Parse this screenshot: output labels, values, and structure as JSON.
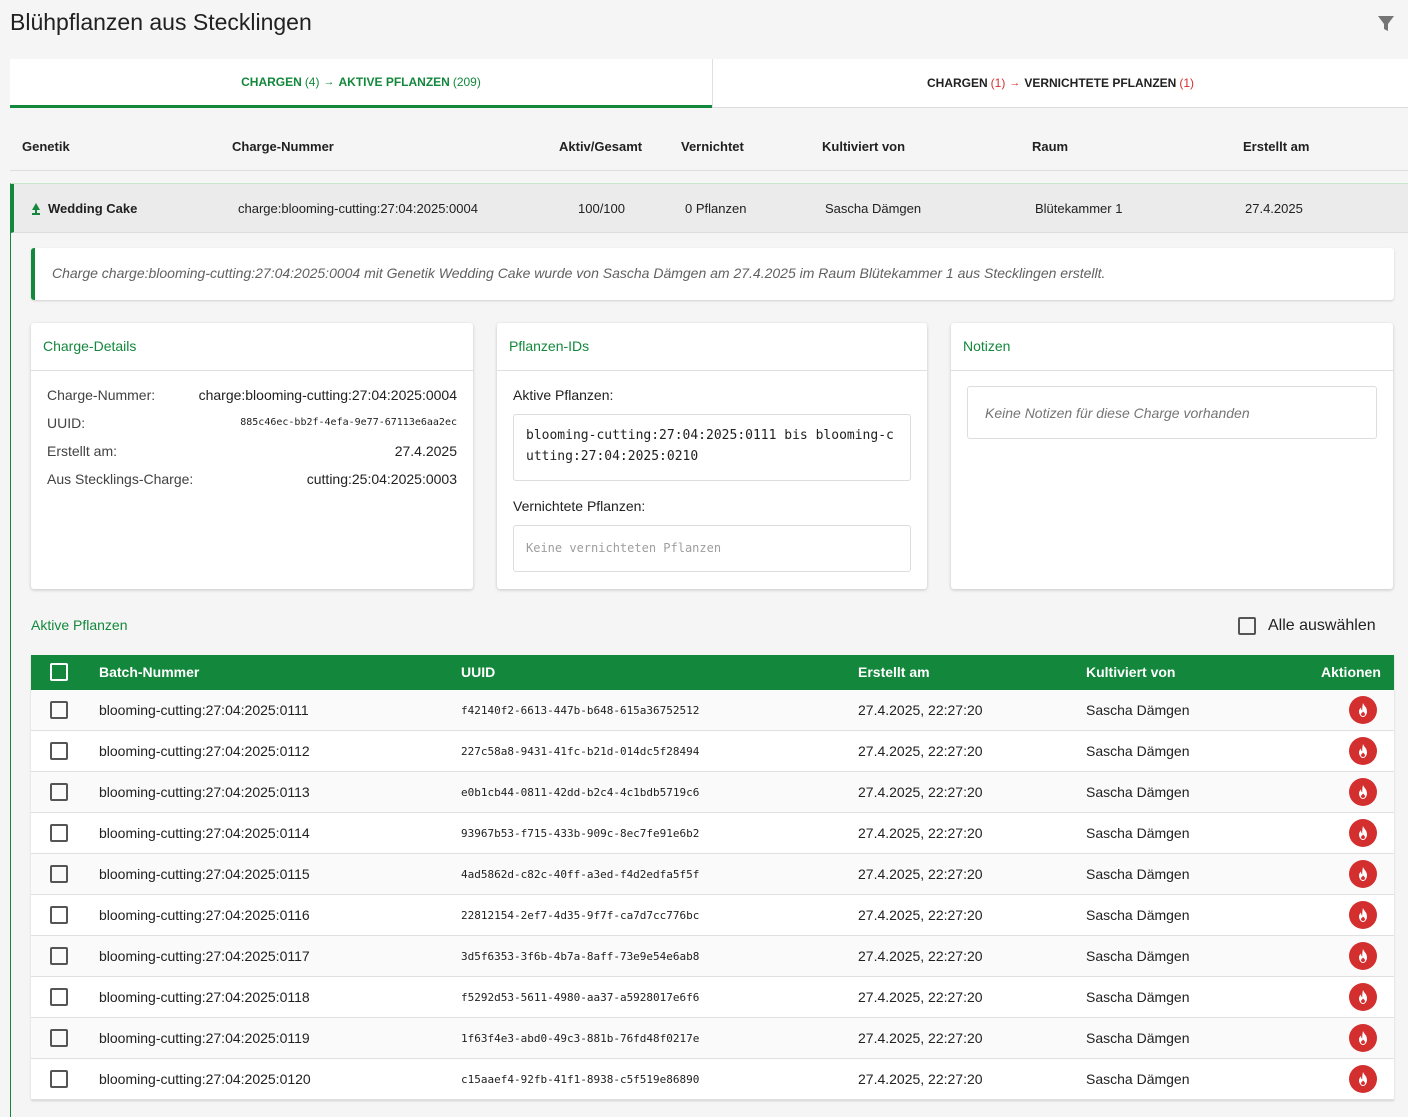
{
  "page": {
    "title": "Blühpflanzen aus Stecklingen",
    "accent": "#13883c",
    "danger": "#d32f2f"
  },
  "header": {
    "filter_icon": "filter-icon"
  },
  "tabs": [
    {
      "prefix": "CHARGEN",
      "prefix_count": "(4)",
      "label": "AKTIVE PFLANZEN",
      "count": "(209)",
      "active": true
    },
    {
      "prefix": "CHARGEN",
      "prefix_count": "(1)",
      "label": "VERNICHTETE PFLANZEN",
      "count": "(1)",
      "active": false
    }
  ],
  "columns": [
    "Genetik",
    "Charge-Nummer",
    "Aktiv/Gesamt",
    "Vernichtet",
    "Kultiviert von",
    "Raum",
    "Erstellt am"
  ],
  "batch": {
    "genetics": "Wedding Cake",
    "number": "charge:blooming-cutting:27:04:2025:0004",
    "active_total": "100/100",
    "destroyed": "0 Pflanzen",
    "cultivated_by": "Sascha Dämgen",
    "room": "Blütekammer 1",
    "created": "27.4.2025",
    "info": "Charge charge:blooming-cutting:27:04:2025:0004 mit Genetik Wedding Cake wurde von Sascha Dämgen am 27.4.2025 im Raum Blütekammer 1 aus Stecklingen erstellt."
  },
  "details": {
    "title": "Charge-Details",
    "number_label": "Charge-Nummer:",
    "number_value": "charge:blooming-cutting:27:04:2025:0004",
    "uuid_label": "UUID:",
    "uuid_value": "885c46ec-bb2f-4efa-9e77-67113e6aa2ec",
    "created_label": "Erstellt am:",
    "created_value": "27.4.2025",
    "source_label": "Aus Stecklings-Charge:",
    "source_value": "cutting:25:04:2025:0003"
  },
  "plant_ids": {
    "title": "Pflanzen-IDs",
    "active_label": "Aktive Pflanzen:",
    "active_value": "blooming-cutting:27:04:2025:0111 bis blooming-cutting:27:04:2025:0210",
    "destroyed_label": "Vernichtete Pflanzen:",
    "destroyed_value": "Keine vernichteten Pflanzen"
  },
  "notes": {
    "title": "Notizen",
    "empty": "Keine Notizen für diese Charge vorhanden"
  },
  "active_plants": {
    "title": "Aktive Pflanzen",
    "select_all": "Alle auswählen",
    "headers": [
      "Batch-Nummer",
      "UUID",
      "Erstellt am",
      "Kultiviert von",
      "Aktionen"
    ],
    "rows": [
      {
        "batch": "blooming-cutting:27:04:2025:0111",
        "uuid": "f42140f2-6613-447b-b648-615a36752512",
        "created": "27.4.2025, 22:27:20",
        "by": "Sascha Dämgen"
      },
      {
        "batch": "blooming-cutting:27:04:2025:0112",
        "uuid": "227c58a8-9431-41fc-b21d-014dc5f28494",
        "created": "27.4.2025, 22:27:20",
        "by": "Sascha Dämgen"
      },
      {
        "batch": "blooming-cutting:27:04:2025:0113",
        "uuid": "e0b1cb44-0811-42dd-b2c4-4c1bdb5719c6",
        "created": "27.4.2025, 22:27:20",
        "by": "Sascha Dämgen"
      },
      {
        "batch": "blooming-cutting:27:04:2025:0114",
        "uuid": "93967b53-f715-433b-909c-8ec7fe91e6b2",
        "created": "27.4.2025, 22:27:20",
        "by": "Sascha Dämgen"
      },
      {
        "batch": "blooming-cutting:27:04:2025:0115",
        "uuid": "4ad5862d-c82c-40ff-a3ed-f4d2edfa5f5f",
        "created": "27.4.2025, 22:27:20",
        "by": "Sascha Dämgen"
      },
      {
        "batch": "blooming-cutting:27:04:2025:0116",
        "uuid": "22812154-2ef7-4d35-9f7f-ca7d7cc776bc",
        "created": "27.4.2025, 22:27:20",
        "by": "Sascha Dämgen"
      },
      {
        "batch": "blooming-cutting:27:04:2025:0117",
        "uuid": "3d5f6353-3f6b-4b7a-8aff-73e9e54e6ab8",
        "created": "27.4.2025, 22:27:20",
        "by": "Sascha Dämgen"
      },
      {
        "batch": "blooming-cutting:27:04:2025:0118",
        "uuid": "f5292d53-5611-4980-aa37-a5928017e6f6",
        "created": "27.4.2025, 22:27:20",
        "by": "Sascha Dämgen"
      },
      {
        "batch": "blooming-cutting:27:04:2025:0119",
        "uuid": "1f63f4e3-abd0-49c3-881b-76fd48f0217e",
        "created": "27.4.2025, 22:27:20",
        "by": "Sascha Dämgen"
      },
      {
        "batch": "blooming-cutting:27:04:2025:0120",
        "uuid": "c15aaef4-92fb-41f1-8938-c5f519e86890",
        "created": "27.4.2025, 22:27:20",
        "by": "Sascha Dämgen"
      }
    ],
    "row_action_icon": "fire-icon"
  }
}
